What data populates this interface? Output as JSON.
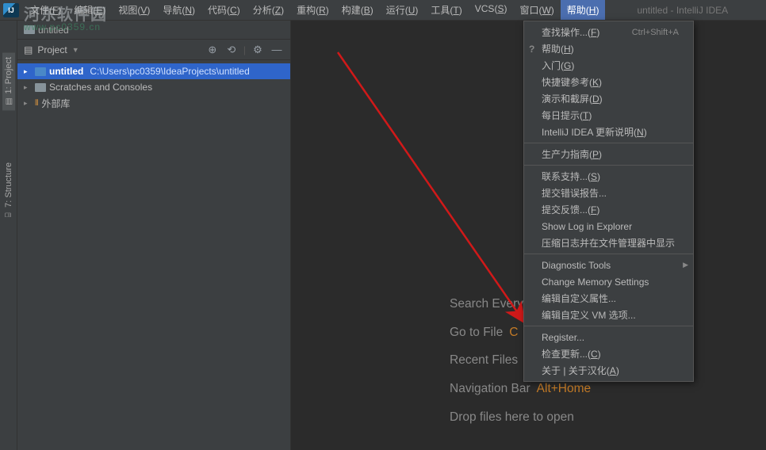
{
  "menubar": {
    "items": [
      "文件(F)",
      "编辑(E)",
      "视图(V)",
      "导航(N)",
      "代码(C)",
      "分析(Z)",
      "重构(R)",
      "构建(B)",
      "运行(U)",
      "工具(T)",
      "VCS(S)",
      "窗口(W)",
      "帮助(H)"
    ],
    "active_index": 12,
    "window_title": "untitled - IntelliJ IDEA"
  },
  "watermark": {
    "big": "河东软件园",
    "small": "www.pc0359.cn"
  },
  "gutter": {
    "tabs": [
      "1: Project",
      "7: Structure"
    ]
  },
  "breadcrumb": {
    "label": "untitled"
  },
  "panel": {
    "title": "Project",
    "tree": [
      {
        "kind": "project",
        "label": "untitled",
        "path": "C:\\Users\\pc0359\\IdeaProjects\\untitled",
        "selected": true,
        "indent": 0
      },
      {
        "kind": "scratches",
        "label": "Scratches and Consoles",
        "selected": false,
        "indent": 0
      },
      {
        "kind": "libs",
        "label": "外部库",
        "selected": false,
        "indent": 0
      }
    ]
  },
  "welcome": {
    "rows": [
      {
        "label": "Search Every",
        "hint": ""
      },
      {
        "label": "Go to File",
        "hint": "C"
      },
      {
        "label": "Recent Files",
        "hint": ""
      },
      {
        "label": "Navigation Bar",
        "hint": "Alt+Home"
      },
      {
        "label": "Drop files here to open",
        "hint": ""
      }
    ]
  },
  "help_menu": {
    "groups": [
      [
        {
          "label": "查找操作...(F)",
          "shortcut": "Ctrl+Shift+A"
        },
        {
          "label": "帮助(H)",
          "icon": "?"
        },
        {
          "label": "入门(G)"
        },
        {
          "label": "快捷键参考(K)"
        },
        {
          "label": "演示和截屏(D)"
        },
        {
          "label": "每日提示(T)"
        },
        {
          "label": "IntelliJ IDEA 更新说明(N)"
        }
      ],
      [
        {
          "label": "生产力指南(P)"
        }
      ],
      [
        {
          "label": "联系支持...(S)"
        },
        {
          "label": "提交错误报告..."
        },
        {
          "label": "提交反馈...(F)"
        },
        {
          "label": "Show Log in Explorer"
        },
        {
          "label": "压缩日志并在文件管理器中显示"
        }
      ],
      [
        {
          "label": "Diagnostic Tools",
          "submenu": true
        },
        {
          "label": "Change Memory Settings"
        },
        {
          "label": "编辑自定义属性..."
        },
        {
          "label": "编辑自定义 VM 选项..."
        }
      ],
      [
        {
          "label": "Register..."
        },
        {
          "label": "检查更新...(C)"
        },
        {
          "label": "关于 | 关于汉化(A)"
        }
      ]
    ]
  }
}
